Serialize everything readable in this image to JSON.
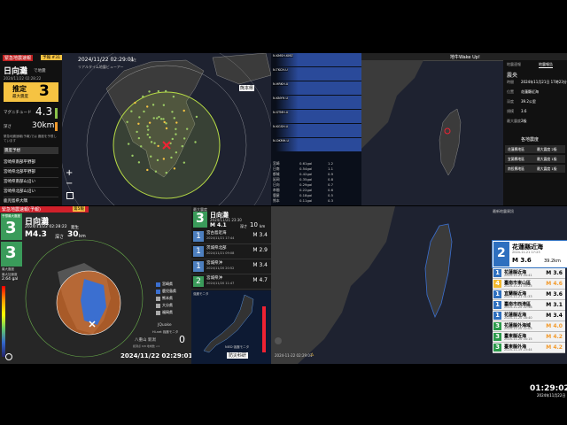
{
  "colors": {
    "warning_red": "#d0202a",
    "sea": "#1c2f55",
    "land": "#3b3b3b",
    "accent_yellow": "#f6c342",
    "orange_ring": "#e0702a",
    "green_ring": "#b8dd45"
  },
  "left_panel": {
    "header": "緊急地震速報",
    "badge": "予報 #31",
    "region": "日向灘",
    "region_sub": "で地震",
    "time": "2024/11/22 02:28:22",
    "estimate_label": "推定",
    "max_int_label": "最大震度",
    "intensity": "3",
    "mag_label": "マグニチュード",
    "magnitude": "4.3",
    "depth_label": "深さ",
    "depth": "30km",
    "note": "緊急地震速報(予報)では 震度を予想しています",
    "list_title": "震度予想",
    "areas": [
      "宮崎県南部平野部",
      "宮崎県北部平野部",
      "宮崎県南部山沿い",
      "宮崎県北部山沿い",
      "鹿児島県大隅"
    ]
  },
  "top_map": {
    "datetime": "2024/11/22 02:29:01",
    "datetime_suffix": "現在",
    "subtitle": "リアルタイム地震ビューアー",
    "label": "熊本県",
    "plus": "+",
    "minus": "−"
  },
  "seis": {
    "traces": [
      "N.KMSH.KMZ",
      "N.TKCH.U",
      "N.HRKH.U",
      "N.KNYH.U",
      "N.STMH.U",
      "N.KGSH.U",
      "N.OKMH.U"
    ],
    "table": [
      [
        "宮崎",
        "0.61gal",
        "1.2"
      ],
      [
        "日南",
        "0.54gal",
        "1.1"
      ],
      [
        "都城",
        "0.42gal",
        "0.9"
      ],
      [
        "延岡",
        "0.35gal",
        "0.8"
      ],
      [
        "日向",
        "0.29gal",
        "0.7"
      ],
      [
        "串間",
        "0.22gal",
        "0.6"
      ],
      [
        "鹿屋",
        "0.18gal",
        "0.5"
      ],
      [
        "熊本",
        "0.11gal",
        "0.3"
      ]
    ]
  },
  "tw_top": {
    "title": "地牛Wake Up!",
    "tab1": "地震速報",
    "tab2": "地震報告",
    "report_title": "震央",
    "fields": [
      [
        "時間",
        "2024年11月21日 17時23分04秒"
      ],
      [
        "位置",
        "花蓮縣近海"
      ],
      [
        "深度",
        "39.2公里"
      ],
      [
        "規模",
        "3.6"
      ],
      [
        "最大震度",
        "2級"
      ]
    ],
    "area_title": "各地震度",
    "areas": [
      [
        "花蓮縣地區",
        "最大震度 2級"
      ],
      [
        "宜蘭縣地區",
        "最大震度 1級"
      ],
      [
        "南投縣地區",
        "最大震度 1級"
      ]
    ]
  },
  "bl_panel": {
    "header": "緊急地震速報(予報)",
    "badge": "第5報",
    "forecast_label": "予想最大震度",
    "intensity": "3",
    "region": "日向灘",
    "time": "2024/11/22 02:28:22",
    "time_suffix": "発生",
    "magnitude": "M4.3",
    "depth_label": "深さ",
    "depth": "30",
    "depth_unit": "km",
    "max_label": "最大震度",
    "observed_intensity": "3",
    "shindo_label": "最大加速度",
    "shindo_value": "2.64 gal",
    "legend": [
      "宮崎県",
      "鹿児島県",
      "熊本県",
      "大分県",
      "福岡県"
    ],
    "legend_colors": [
      "#3b6fd0",
      "#3b6fd0",
      "#aaa",
      "#aaa",
      "#aaa"
    ],
    "corner_label": "JQuake",
    "corner_sub": "Hi-net 強震モニタ",
    "count_label": "八重山 新潟",
    "count_sub": "観測点 6/8 地域数 <1",
    "count_value": "0",
    "footer_time": "2024/11/22 02:29:01"
  },
  "jq_list": {
    "header": "最大震度",
    "first_int": "3",
    "first_region": "日向灘",
    "first_time": "2024/11/21 23:30",
    "first_depth_label": "深さ",
    "first_depth": "10",
    "first_depth_unit": "km",
    "first_mag": "M 4.1",
    "rows": [
      {
        "int": "1",
        "name": "宮古島近海",
        "time": "2024/11/21 17:44",
        "mag": "M 3.4",
        "color": "#4d7fbf"
      },
      {
        "int": "1",
        "name": "茨城県北部",
        "time": "2024/11/21 09:08",
        "mag": "M 2.9",
        "color": "#4d7fbf"
      },
      {
        "int": "1",
        "name": "宮城県沖",
        "time": "2024/11/20 20:52",
        "mag": "M 3.4",
        "color": "#4d7fbf"
      },
      {
        "int": "2",
        "name": "宮城県沖",
        "time": "2024/11/20 11:47",
        "mag": "M 4.7",
        "color": "#3a9b5a"
      }
    ],
    "mini_label": "強震モニタ",
    "mini_footer": "防災科研",
    "mini_source": "NIED 強震モニタ"
  },
  "tw_bottom": {
    "top_label": "最新地震資訊",
    "main": {
      "int": "2",
      "name": "花蓮縣近海",
      "date": "2024-11-21 17:23",
      "mag": "M 3.6",
      "depth": "39.2km"
    },
    "rows": [
      {
        "int": "1",
        "name": "花蓮縣近海",
        "date": "2024-11-21 04:41",
        "mag": "M 3.6",
        "color": "#2e6fbf",
        "magcolor": "#000"
      },
      {
        "int": "4",
        "name": "臺南市東山區",
        "date": "2024-11-21 03:25",
        "mag": "M 4.6",
        "color": "#f2b82c",
        "magcolor": "#f29a2c"
      },
      {
        "int": "1",
        "name": "宜蘭縣近海",
        "date": "2024-11-21 01:33",
        "mag": "M 3.6",
        "color": "#2e6fbf",
        "magcolor": "#000"
      },
      {
        "int": "1",
        "name": "臺南市西港區",
        "date": "2024-11-20 22:58",
        "mag": "M 3.1",
        "color": "#2e6fbf",
        "magcolor": "#000"
      },
      {
        "int": "1",
        "name": "花蓮縣近海",
        "date": "2024-11-20 18:40",
        "mag": "M 3.4",
        "color": "#2e6fbf",
        "magcolor": "#000"
      },
      {
        "int": "3",
        "name": "花蓮縣外海域",
        "date": "2024-11-20 12:03",
        "mag": "M 4.0",
        "color": "#2a9a4a",
        "magcolor": "#f29a2c"
      },
      {
        "int": "3",
        "name": "臺東縣近海",
        "date": "2024-11-20 04:15",
        "mag": "M 4.2",
        "color": "#2a9a4a",
        "magcolor": "#f29a2c"
      },
      {
        "int": "3",
        "name": "臺東縣外海",
        "date": "2024-11-19 23:44",
        "mag": "M 4.2",
        "color": "#2a9a4a",
        "magcolor": "#f29a2c"
      }
    ],
    "footer_time": "2024-11-22 02:29:01",
    "footer_warn": "⚠"
  },
  "clock": {
    "time": "01:29:02",
    "date": "2024年11月22日"
  }
}
